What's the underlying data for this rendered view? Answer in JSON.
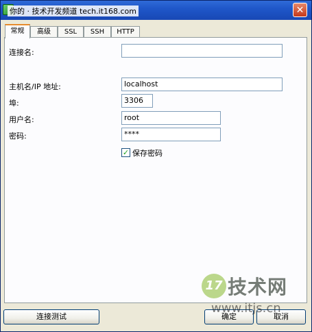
{
  "window": {
    "title": "你的 · 技术开发频道 tech.it168.com",
    "close_glyph": "✕"
  },
  "tabs": [
    {
      "label": "常规",
      "active": true
    },
    {
      "label": "高级",
      "active": false
    },
    {
      "label": "SSL",
      "active": false
    },
    {
      "label": "SSH",
      "active": false
    },
    {
      "label": "HTTP",
      "active": false
    }
  ],
  "form": {
    "connection_name_label": "连接名:",
    "connection_name_value": "",
    "host_label": "主机名/IP 地址:",
    "host_value": "localhost",
    "port_label": "埠:",
    "port_value": "3306",
    "user_label": "用户名:",
    "user_value": "root",
    "password_label": "密码:",
    "password_value": "****",
    "save_password_label": "保存密码",
    "save_password_checked": true,
    "checkmark": "✓"
  },
  "buttons": {
    "test_connection": "连接测试",
    "ok": "确定",
    "cancel": "取消"
  },
  "watermark": {
    "badge": "17",
    "brand": "技术网",
    "url": "www.itjs.cn"
  },
  "colors": {
    "titlebar": "#1f57c9",
    "active_tab_accent": "#e68b2c",
    "field_border": "#7f9db9"
  }
}
